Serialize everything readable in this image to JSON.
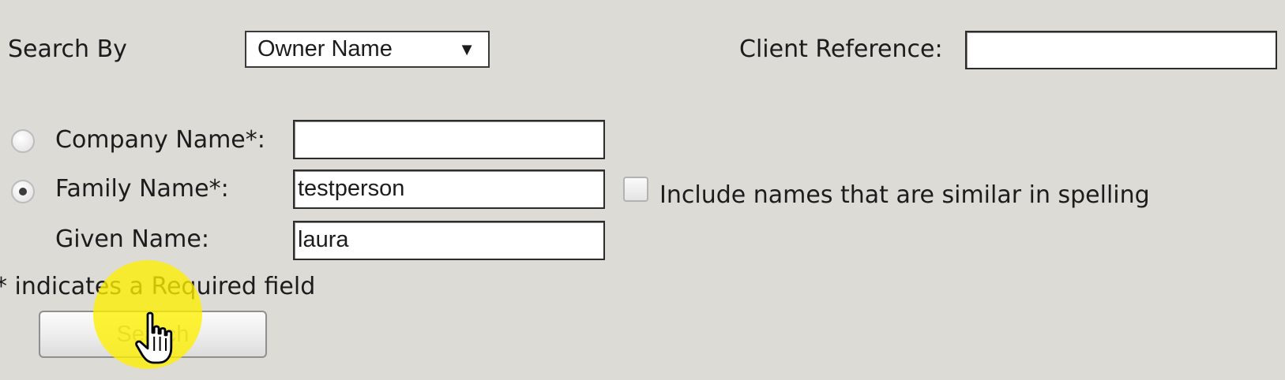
{
  "search_by": {
    "label": "Search By",
    "selected": "Owner Name"
  },
  "client_reference": {
    "label": "Client Reference:",
    "value": ""
  },
  "company_name": {
    "label": "Company Name*:",
    "value": "",
    "selected": false
  },
  "family_name": {
    "label": "Family Name*:",
    "value": "testperson",
    "selected": true
  },
  "similar_spelling": {
    "label": "Include names that are similar in spelling",
    "checked": false
  },
  "given_name": {
    "label": "Given Name:",
    "value": "laura"
  },
  "required_note": "* indicates a Required field",
  "search_button": {
    "label": "Search"
  },
  "icons": {
    "dropdown": "triangle-down-icon",
    "pointer": "hand-pointer-icon"
  },
  "colors": {
    "background": "#dcdbd6",
    "click_highlight": "#fff000"
  }
}
